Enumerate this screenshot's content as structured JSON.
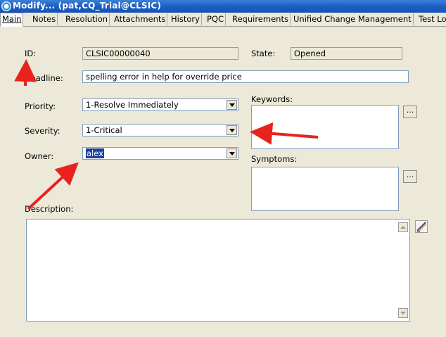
{
  "window": {
    "title": "Modify... (pat,CQ_Trial@CLSIC)"
  },
  "tabs": [
    {
      "label": "Main",
      "active": true
    },
    {
      "label": "Notes"
    },
    {
      "label": "Resolution"
    },
    {
      "label": "Attachments"
    },
    {
      "label": "History"
    },
    {
      "label": "PQC"
    },
    {
      "label": "Requirements"
    },
    {
      "label": "Unified Change Management"
    },
    {
      "label": "Test Lo"
    }
  ],
  "form": {
    "id": {
      "label": "ID:",
      "value": "CLSIC00000040"
    },
    "state": {
      "label": "State:",
      "value": "Opened"
    },
    "headline": {
      "label": "Headline:",
      "value": "spelling error in help for override price"
    },
    "priority": {
      "label": "Priority:",
      "value": "1-Resolve Immediately"
    },
    "severity": {
      "label": "Severity:",
      "value": "1-Critical"
    },
    "owner": {
      "label": "Owner:",
      "value": "alex"
    },
    "keywords": {
      "label": "Keywords:",
      "button": "..."
    },
    "symptoms": {
      "label": "Symptoms:",
      "button": "..."
    },
    "description": {
      "label": "Description:"
    }
  },
  "annotations": {
    "arrow_color": "#e8231e"
  }
}
